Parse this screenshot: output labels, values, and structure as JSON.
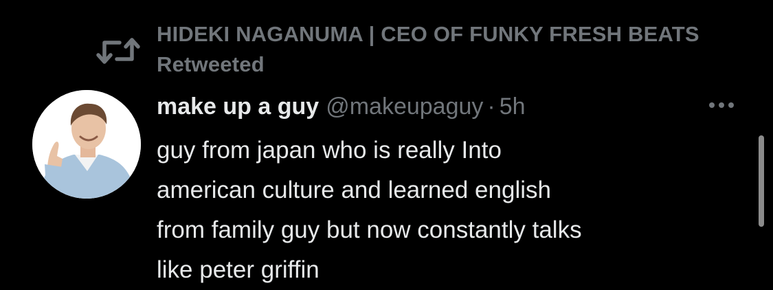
{
  "retweet": {
    "icon": "retweet-icon",
    "text": "HIDEKI NAGANUMA | CEO OF FUNKY FRESH BEATS Retweeted"
  },
  "tweet": {
    "avatar": "avatar-photo",
    "display_name": "make up a guy",
    "handle": "@makeupaguy",
    "separator": "·",
    "time": "5h",
    "more_icon": "more-options-icon",
    "text": "guy from japan who is really Into\namerican culture and learned english\nfrom family guy but now constantly talks\nlike peter griffin"
  },
  "colors": {
    "background": "#000000",
    "primary_text": "#e7e9ea",
    "secondary_text": "#71767b"
  }
}
